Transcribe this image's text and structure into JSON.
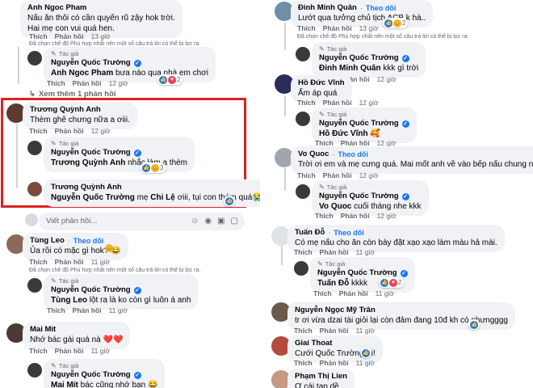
{
  "actions": {
    "like": "Thích",
    "reply": "Phản hồi"
  },
  "author_tag": "Tác giả",
  "follow_label": "Theo dõi",
  "moderation_note": "Đã chọn chế độ Phù hợp nhất nên một số câu trả lời có thể bị lọc ra.",
  "reply_placeholder": "Viết phản hồi...",
  "colors": {
    "accent": "#1877f2",
    "highlight": "#e02020",
    "bubble": "#f0f2f5"
  },
  "left": {
    "c1": {
      "author": "Anh Ngoc Pham",
      "line1": "Nấu ăn thôi có cần quyến rũ zậy hok trời.",
      "line2": "Hai mẹ con vui quá hen.",
      "time": "13 giờ"
    },
    "r1": {
      "author": "Nguyễn Quốc Trường",
      "mention": "Anh Ngoc Pham",
      "text": " bưa nào qua nhà em chơi",
      "count": "2",
      "time": "12 giờ"
    },
    "more_replies": "Xem thêm 1 phản hồi",
    "c2": {
      "author": "Trương Quỳnh Anh",
      "text": "Thèm ghê chưng nữa a ơiii.",
      "time": "12 giờ"
    },
    "r2": {
      "author": "Nguyễn Quốc Trường",
      "mention": "Trương Quỳnh Anh",
      "text": " nhắc làm a thèm",
      "count": "3"
    },
    "r3": {
      "author": "Trương Quỳnh Anh",
      "mention1": "Nguyễn Quốc Trường",
      "mid": " mẹ ",
      "mention2": "Chi Lệ",
      "text": " ơiii, tụi con thèm quá",
      "emoji": "😭😭"
    },
    "c3": {
      "author": "Tùng Leo",
      "text": "Ủa rồi có mặc gì hok?",
      "emoji": "😂",
      "time": "11 giờ"
    },
    "r4": {
      "author": "Nguyễn Quốc Trường",
      "mention": "Tùng Leo",
      "text": " lột ra là ko còn gì luôn á anh",
      "time": "11 giờ"
    },
    "c4": {
      "author": "Mai Mit",
      "text": "Nhớ bác gái quá nà",
      "emoji": "❤️❤️",
      "time": "11 giờ"
    },
    "r5": {
      "author": "Nguyễn Quốc Trường",
      "mention": "Mai Mit",
      "text": " bác cũng nhớ bạn",
      "emoji": "😂"
    }
  },
  "right": {
    "c1": {
      "author": "Đinh Minh Quân",
      "text": "Lướt qua tưởng chủ tịch ACB k hà..",
      "count": "2",
      "time": "13 giờ"
    },
    "r1": {
      "author": "Nguyễn Quốc Trường",
      "mention": "Đinh Minh Quân",
      "text": " kkk gì trời",
      "time": "12 giờ"
    },
    "c2": {
      "author": "Hồ Đức Vĩnh",
      "text": "Ấm áp quá",
      "time": "12 giờ"
    },
    "r2": {
      "author": "Nguyễn Quốc Trường",
      "mention": "Hồ Đức Vĩnh",
      "emoji": "🥰",
      "time": "12 giờ"
    },
    "c3": {
      "author": "Vo Quoc",
      "text": "Trời ơi em và mẹ cưng quá. Mai mốt anh về vào bếp nấu chung nhen",
      "time": "12 giờ"
    },
    "r3": {
      "author": "Nguyễn Quốc Trường",
      "mention": "Vo Quoc",
      "text": " cuối tháng nhe kkk",
      "time": "12 giờ"
    },
    "c4": {
      "author": "Tuấn Đỗ",
      "text": "Có mẹ nấu cho ăn còn bày đặt xạo xạo làm màu hả mài.",
      "time": "11 giờ"
    },
    "r4": {
      "author": "Nguyễn Quốc Trường",
      "mention": "Tuấn Đỗ",
      "text": " kkkk",
      "count": "2",
      "time": "11 giờ"
    },
    "c5": {
      "author": "Nguyễn Ngọc Mỹ Trân",
      "text": "tr ơi vừa dzai tài giỏi lại còn đảm đang 10đ kh có nhưngggg",
      "time": "11 giờ"
    },
    "c6": {
      "author": "Giai Thoat",
      "text": "Cưới Quốc Trường ơi!",
      "time": "11 giờ"
    },
    "c7": {
      "author": "Phạm Thị Lien",
      "text": "Ơ cái tạp dề"
    }
  }
}
